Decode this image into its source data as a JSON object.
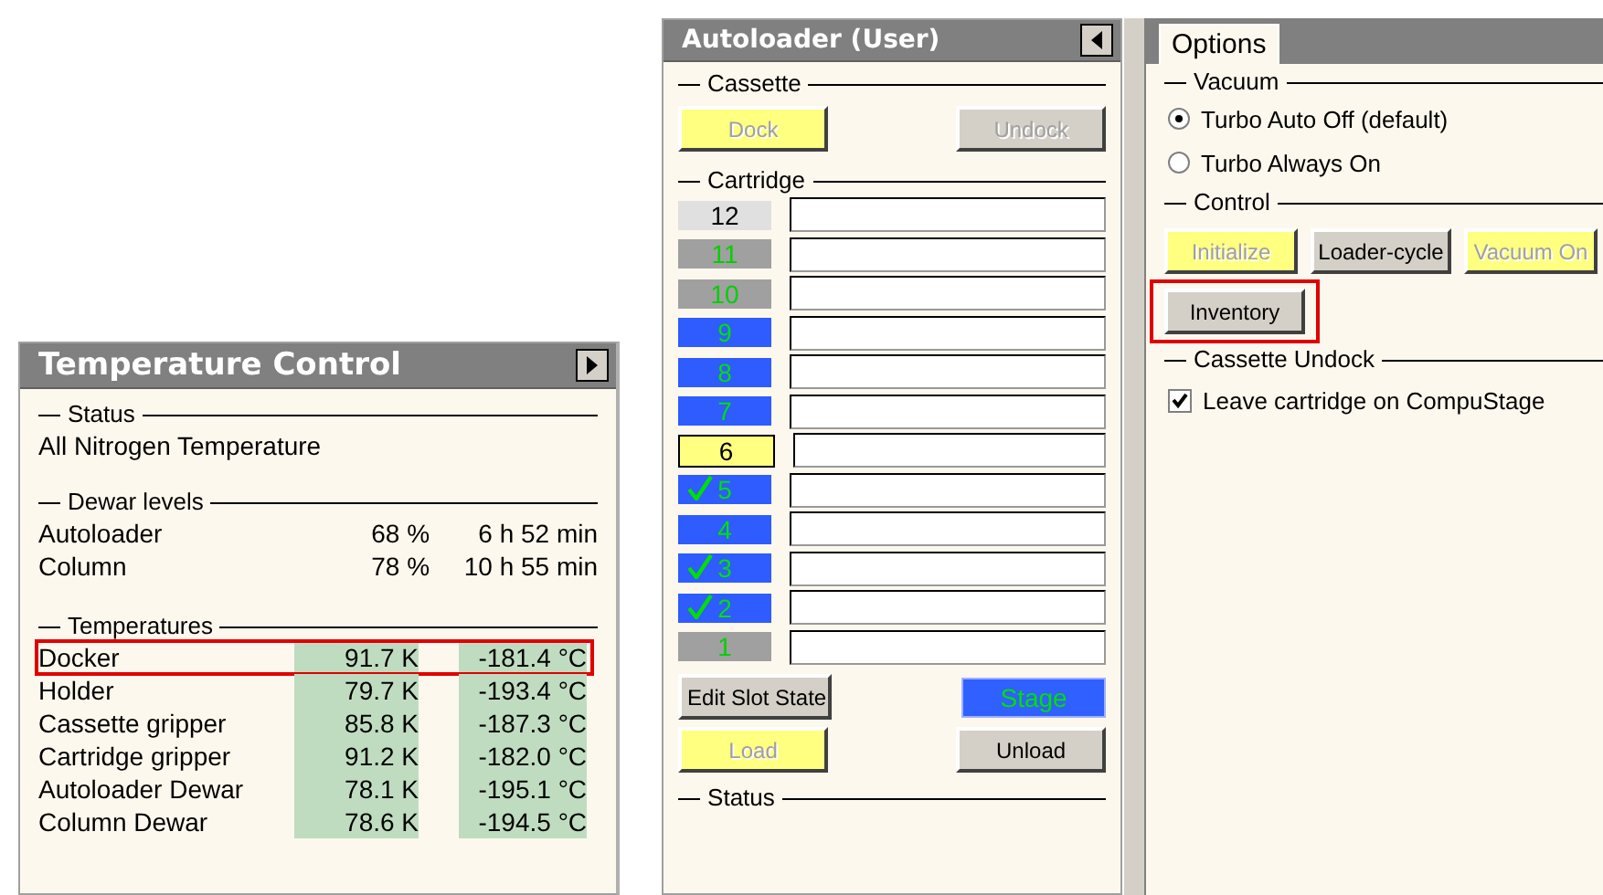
{
  "temperature_control": {
    "title": "Temperature Control",
    "status": {
      "heading": "Status",
      "text": "All Nitrogen Temperature"
    },
    "dewar_levels": {
      "heading": "Dewar levels",
      "rows": [
        {
          "name": "Autoloader",
          "percent": "68 %",
          "time": "6 h 52 min"
        },
        {
          "name": "Column",
          "percent": "78 %",
          "time": "10 h 55 min"
        }
      ]
    },
    "temperatures": {
      "heading": "Temperatures",
      "rows": [
        {
          "name": "Docker",
          "kelvin": "91.7 K",
          "celsius": "-181.4 °C",
          "highlighted": true
        },
        {
          "name": "Holder",
          "kelvin": "79.7 K",
          "celsius": "-193.4 °C",
          "highlighted": false
        },
        {
          "name": "Cassette gripper",
          "kelvin": "85.8 K",
          "celsius": "-187.3 °C",
          "highlighted": false
        },
        {
          "name": "Cartridge gripper",
          "kelvin": "91.2 K",
          "celsius": "-182.0 °C",
          "highlighted": false
        },
        {
          "name": "Autoloader Dewar",
          "kelvin": "78.1 K",
          "celsius": "-195.1 °C",
          "highlighted": false
        },
        {
          "name": "Column Dewar",
          "kelvin": "78.6 K",
          "celsius": "-194.5 °C",
          "highlighted": false
        }
      ]
    }
  },
  "autoloader": {
    "title": "Autoloader (User)",
    "cassette": {
      "heading": "Cassette",
      "buttons": [
        {
          "label": "Dock",
          "kind": "warning",
          "disabled": true
        },
        {
          "label": "Undock",
          "kind": "normal",
          "disabled": true
        }
      ]
    },
    "cartridge": {
      "heading": "Cartridge",
      "slots": [
        {
          "number": "12",
          "kind": "unknown",
          "checked": false
        },
        {
          "number": "11",
          "kind": "empty",
          "checked": false
        },
        {
          "number": "10",
          "kind": "empty",
          "checked": false
        },
        {
          "number": "9",
          "kind": "loaded",
          "checked": false
        },
        {
          "number": "8",
          "kind": "loaded",
          "checked": false
        },
        {
          "number": "7",
          "kind": "loaded",
          "checked": false
        },
        {
          "number": "6",
          "kind": "current",
          "checked": false
        },
        {
          "number": "5",
          "kind": "loaded",
          "checked": true
        },
        {
          "number": "4",
          "kind": "loaded",
          "checked": false
        },
        {
          "number": "3",
          "kind": "loaded",
          "checked": true
        },
        {
          "number": "2",
          "kind": "loaded",
          "checked": true
        },
        {
          "number": "1",
          "kind": "empty",
          "checked": false
        }
      ],
      "button_rows": [
        [
          {
            "label": "Edit Slot State",
            "kind": "normal",
            "disabled": false
          },
          {
            "label": "Stage",
            "kind": "stage",
            "disabled": false
          }
        ],
        [
          {
            "label": "Load",
            "kind": "warning",
            "disabled": true
          },
          {
            "label": "Unload",
            "kind": "normal",
            "disabled": false
          }
        ]
      ]
    },
    "status": {
      "heading": "Status"
    }
  },
  "options": {
    "tabs": [
      {
        "label": "Options",
        "selected": true
      }
    ],
    "vacuum": {
      "heading": "Vacuum",
      "radios": [
        {
          "label": "Turbo Auto Off (default)",
          "selected": true
        },
        {
          "label": "Turbo Always On",
          "selected": false
        }
      ]
    },
    "control": {
      "heading": "Control",
      "buttons": [
        {
          "label": "Initialize",
          "kind": "warning",
          "disabled": true,
          "highlighted": false
        },
        {
          "label": "Loader-cycle",
          "kind": "normal",
          "disabled": false,
          "highlighted": false
        },
        {
          "label": "Vacuum On",
          "kind": "warning",
          "disabled": true,
          "highlighted": false
        },
        {
          "label": "Inventory",
          "kind": "normal",
          "disabled": false,
          "highlighted": true
        }
      ]
    },
    "cassette_undock": {
      "heading": "Cassette Undock",
      "checkboxes": [
        {
          "label": "Leave cartridge on CompuStage",
          "checked": true
        }
      ]
    }
  }
}
